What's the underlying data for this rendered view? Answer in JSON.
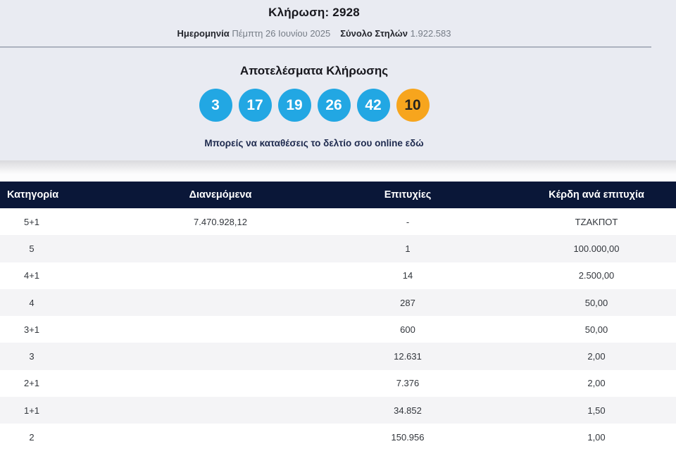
{
  "colors": {
    "top_background": "#e9ebf2",
    "table_header_navy": "#0a1738",
    "ball_blue": "#22a7e3",
    "ball_orange": "#f7a51d",
    "row_alt_gray": "#f4f4f6"
  },
  "header": {
    "draw_title": "Κλήρωση: 2928",
    "date_label": "Ημερομηνία",
    "date_value": "Πέμπτη 26 Ιουνίου 2025",
    "total_columns_label": "Σύνολο Στηλών",
    "total_columns_value": "1.922.583"
  },
  "results": {
    "title": "Αποτελέσματα Κλήρωσης",
    "numbers": [
      "3",
      "17",
      "19",
      "26",
      "42"
    ],
    "bonus_number": "10",
    "cta_text": "Μπορείς να καταθέσεις το δελτίο σου online εδώ"
  },
  "table": {
    "headers": [
      "Κατηγορία",
      "Διανεμόμενα",
      "Επιτυχίες",
      "Κέρδη ανά επιτυχία"
    ],
    "rows": [
      {
        "category": "5+1",
        "distributed": "7.470.928,12",
        "winners": "-",
        "prize": "ΤΖΑΚΠΟΤ"
      },
      {
        "category": "5",
        "distributed": "",
        "winners": "1",
        "prize": "100.000,00"
      },
      {
        "category": "4+1",
        "distributed": "",
        "winners": "14",
        "prize": "2.500,00"
      },
      {
        "category": "4",
        "distributed": "",
        "winners": "287",
        "prize": "50,00"
      },
      {
        "category": "3+1",
        "distributed": "",
        "winners": "600",
        "prize": "50,00"
      },
      {
        "category": "3",
        "distributed": "",
        "winners": "12.631",
        "prize": "2,00"
      },
      {
        "category": "2+1",
        "distributed": "",
        "winners": "7.376",
        "prize": "2,00"
      },
      {
        "category": "1+1",
        "distributed": "",
        "winners": "34.852",
        "prize": "1,50"
      },
      {
        "category": "2",
        "distributed": "",
        "winners": "150.956",
        "prize": "1,00"
      }
    ]
  }
}
